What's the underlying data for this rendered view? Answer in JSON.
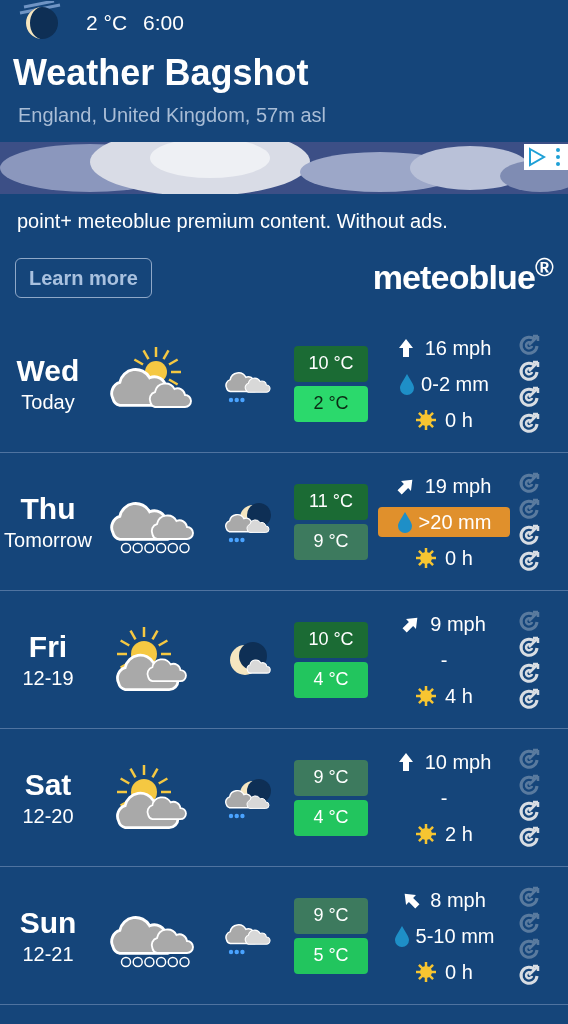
{
  "header": {
    "temperature": "2 °C",
    "time": "6:00",
    "title": "Weather Bagshot",
    "subtitle": "England, United Kingdom, 57m asl"
  },
  "ad": {
    "text": "point+ meteoblue premium content. Without ads.",
    "button": "Learn more",
    "logo": "meteoblue$^{®}$"
  },
  "days": [
    {
      "day": "Wed",
      "date": "Today",
      "weather": {
        "kind": "partly_cloudy"
      },
      "night": {
        "kind": "rain_cloud"
      },
      "high": {
        "text": "10 °C",
        "color": "#1b6b34"
      },
      "low": {
        "text": "2 °C",
        "color": "#2bd96c"
      },
      "wind": {
        "kind": "n",
        "text": "16 mph"
      },
      "precip": {
        "text": "0-2 mm",
        "drop": true,
        "highlight": false
      },
      "sun": "0 h",
      "predictability": [
        false,
        true,
        true,
        true
      ]
    },
    {
      "day": "Thu",
      "date": "Tomorrow",
      "weather": {
        "kind": "rain_heavy"
      },
      "night": {
        "kind": "moon_rain_cloud"
      },
      "high": {
        "text": "11 °C",
        "color": "#1b6b34"
      },
      "low": {
        "text": "9 °C",
        "color": "#3d7a5e"
      },
      "wind": {
        "kind": "ne",
        "text": "19 mph"
      },
      "precip": {
        "text": ">20 mm",
        "drop": true,
        "highlight": true
      },
      "sun": "0 h",
      "predictability": [
        false,
        false,
        true,
        true
      ]
    },
    {
      "day": "Fri",
      "date": "12-19",
      "weather": {
        "kind": "sun_cloud"
      },
      "night": {
        "kind": "moon_cloud"
      },
      "high": {
        "text": "10 °C",
        "color": "#1b6b34"
      },
      "low": {
        "text": "4 °C",
        "color": "#22c55e"
      },
      "wind": {
        "kind": "ne",
        "text": "9 mph"
      },
      "precip": {
        "text": "-",
        "drop": false,
        "highlight": false
      },
      "sun": "4 h",
      "predictability": [
        false,
        true,
        true,
        true
      ]
    },
    {
      "day": "Sat",
      "date": "12-20",
      "weather": {
        "kind": "sun_cloud"
      },
      "night": {
        "kind": "moon_rain_cloud"
      },
      "high": {
        "text": "9 °C",
        "color": "#3d7a5e"
      },
      "low": {
        "text": "4 °C",
        "color": "#22c55e"
      },
      "wind": {
        "kind": "n",
        "text": "10 mph"
      },
      "precip": {
        "text": "-",
        "drop": false,
        "highlight": false
      },
      "sun": "2 h",
      "predictability": [
        false,
        false,
        true,
        true
      ]
    },
    {
      "day": "Sun",
      "date": "12-21",
      "weather": {
        "kind": "rain_heavy"
      },
      "night": {
        "kind": "rain_cloud"
      },
      "high": {
        "text": "9 °C",
        "color": "#3d7a5e"
      },
      "low": {
        "text": "5 °C",
        "color": "#22c55e"
      },
      "wind": {
        "kind": "nw",
        "text": "8 mph"
      },
      "precip": {
        "text": "5-10 mm",
        "drop": true,
        "highlight": false
      },
      "sun": "0 h",
      "predictability": [
        false,
        false,
        false,
        true
      ]
    }
  ]
}
